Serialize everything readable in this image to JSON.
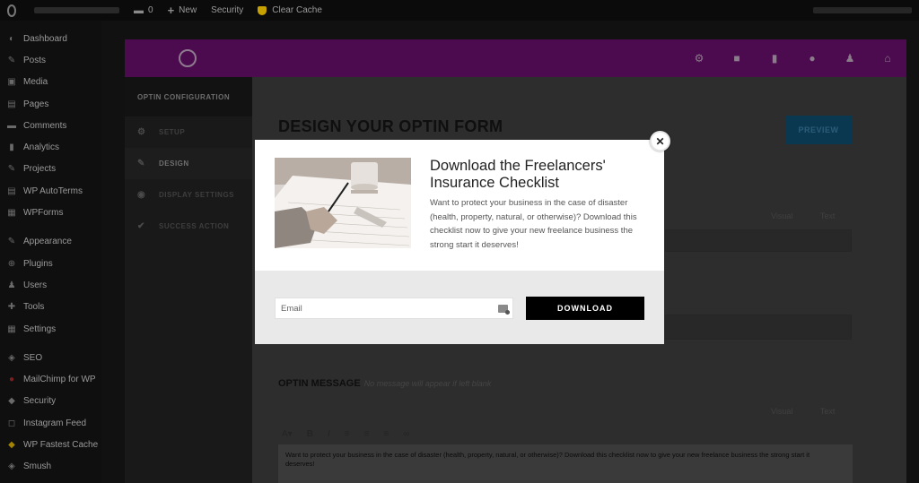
{
  "admin_bar": {
    "comments_count": "0",
    "new_label": "New",
    "security_label": "Security",
    "clear_cache_label": "Clear Cache"
  },
  "sidebar": {
    "items": [
      {
        "label": "Dashboard",
        "icon": "dashboard-icon"
      },
      {
        "label": "Posts",
        "icon": "pin-icon"
      },
      {
        "label": "Media",
        "icon": "media-icon"
      },
      {
        "label": "Pages",
        "icon": "page-icon"
      },
      {
        "label": "Comments",
        "icon": "comment-icon"
      },
      {
        "label": "Analytics",
        "icon": "analytics-icon"
      },
      {
        "label": "Projects",
        "icon": "pin-icon"
      },
      {
        "label": "WP AutoTerms",
        "icon": "document-icon"
      },
      {
        "label": "WPForms",
        "icon": "form-icon"
      },
      {
        "label": "Appearance",
        "icon": "brush-icon"
      },
      {
        "label": "Plugins",
        "icon": "plugin-icon"
      },
      {
        "label": "Users",
        "icon": "user-icon"
      },
      {
        "label": "Tools",
        "icon": "wrench-icon"
      },
      {
        "label": "Settings",
        "icon": "settings-icon"
      },
      {
        "label": "SEO",
        "icon": "seo-icon"
      },
      {
        "label": "MailChimp for WP",
        "icon": "mailchimp-icon"
      },
      {
        "label": "Security",
        "icon": "shield-icon"
      },
      {
        "label": "Instagram Feed",
        "icon": "instagram-icon"
      },
      {
        "label": "WP Fastest Cache",
        "icon": "cache-icon"
      },
      {
        "label": "Smush",
        "icon": "smush-icon"
      }
    ]
  },
  "config_panel": {
    "title": "OPTIN CONFIGURATION",
    "items": [
      "SETUP",
      "DESIGN",
      "DISPLAY SETTINGS",
      "SUCCESS ACTION"
    ]
  },
  "main": {
    "title": "DESIGN YOUR OPTIN FORM",
    "preview_label": "PREVIEW",
    "tab_visual": "Visual",
    "tab_text": "Text",
    "optin_message_title": "OPTIN MESSAGE",
    "optin_message_hint": "No message will appear if left blank",
    "editor_text": "Want to protect your business in the case of disaster (health, property, natural, or otherwise)? Download this checklist now to give your new freelance business the strong start it deserves!"
  },
  "modal": {
    "heading": "Download the Freelancers' Insurance Checklist",
    "body": "Want to protect your business in the case of disaster (health, property, natural, or otherwise)? Download this checklist now to give your new freelance business the strong start it deserves!",
    "email_placeholder": "Email",
    "button_label": "DOWNLOAD",
    "close_label": "✕"
  },
  "colors": {
    "header_purple": "#4d0b4f",
    "button_black": "#000000",
    "overlay_dark": "#111111"
  }
}
